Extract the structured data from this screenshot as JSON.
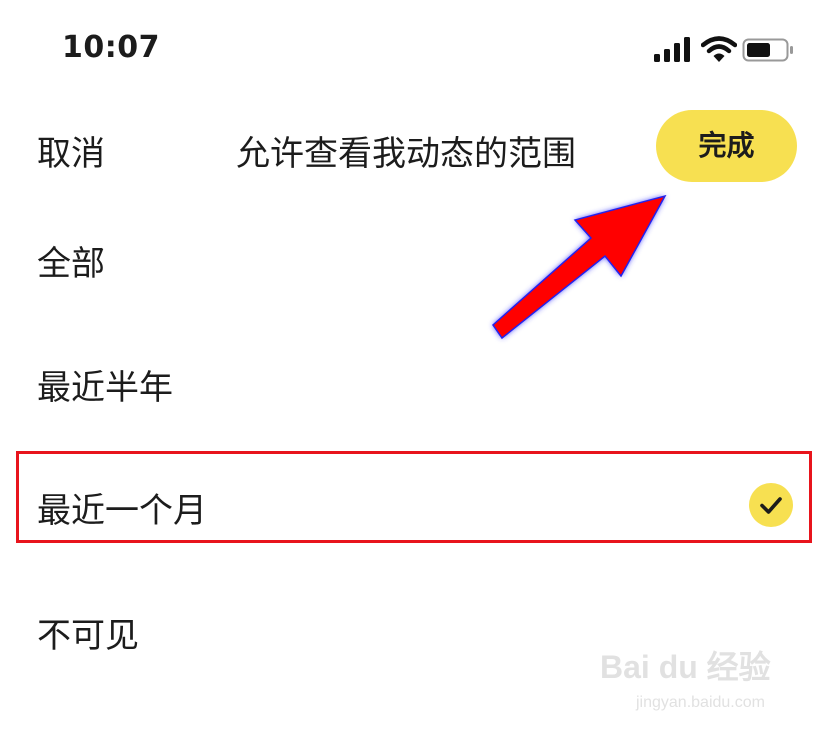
{
  "status_bar": {
    "time": "10:07",
    "icons": [
      "signal-icon",
      "wifi-icon",
      "battery-icon"
    ]
  },
  "nav": {
    "cancel_label": "取消",
    "title": "允许查看我动态的范围",
    "done_label": "完成"
  },
  "options": [
    {
      "label": "全部",
      "selected": false
    },
    {
      "label": "最近半年",
      "selected": false
    },
    {
      "label": "最近一个月",
      "selected": true
    },
    {
      "label": "不可见",
      "selected": false
    }
  ],
  "colors": {
    "accent": "#f7e051",
    "annotation_red": "#e8141c",
    "arrow_glow": "#3a3aff"
  },
  "watermark": {
    "main": "Bai du 经验",
    "sub": "jingyan.baidu.com"
  }
}
